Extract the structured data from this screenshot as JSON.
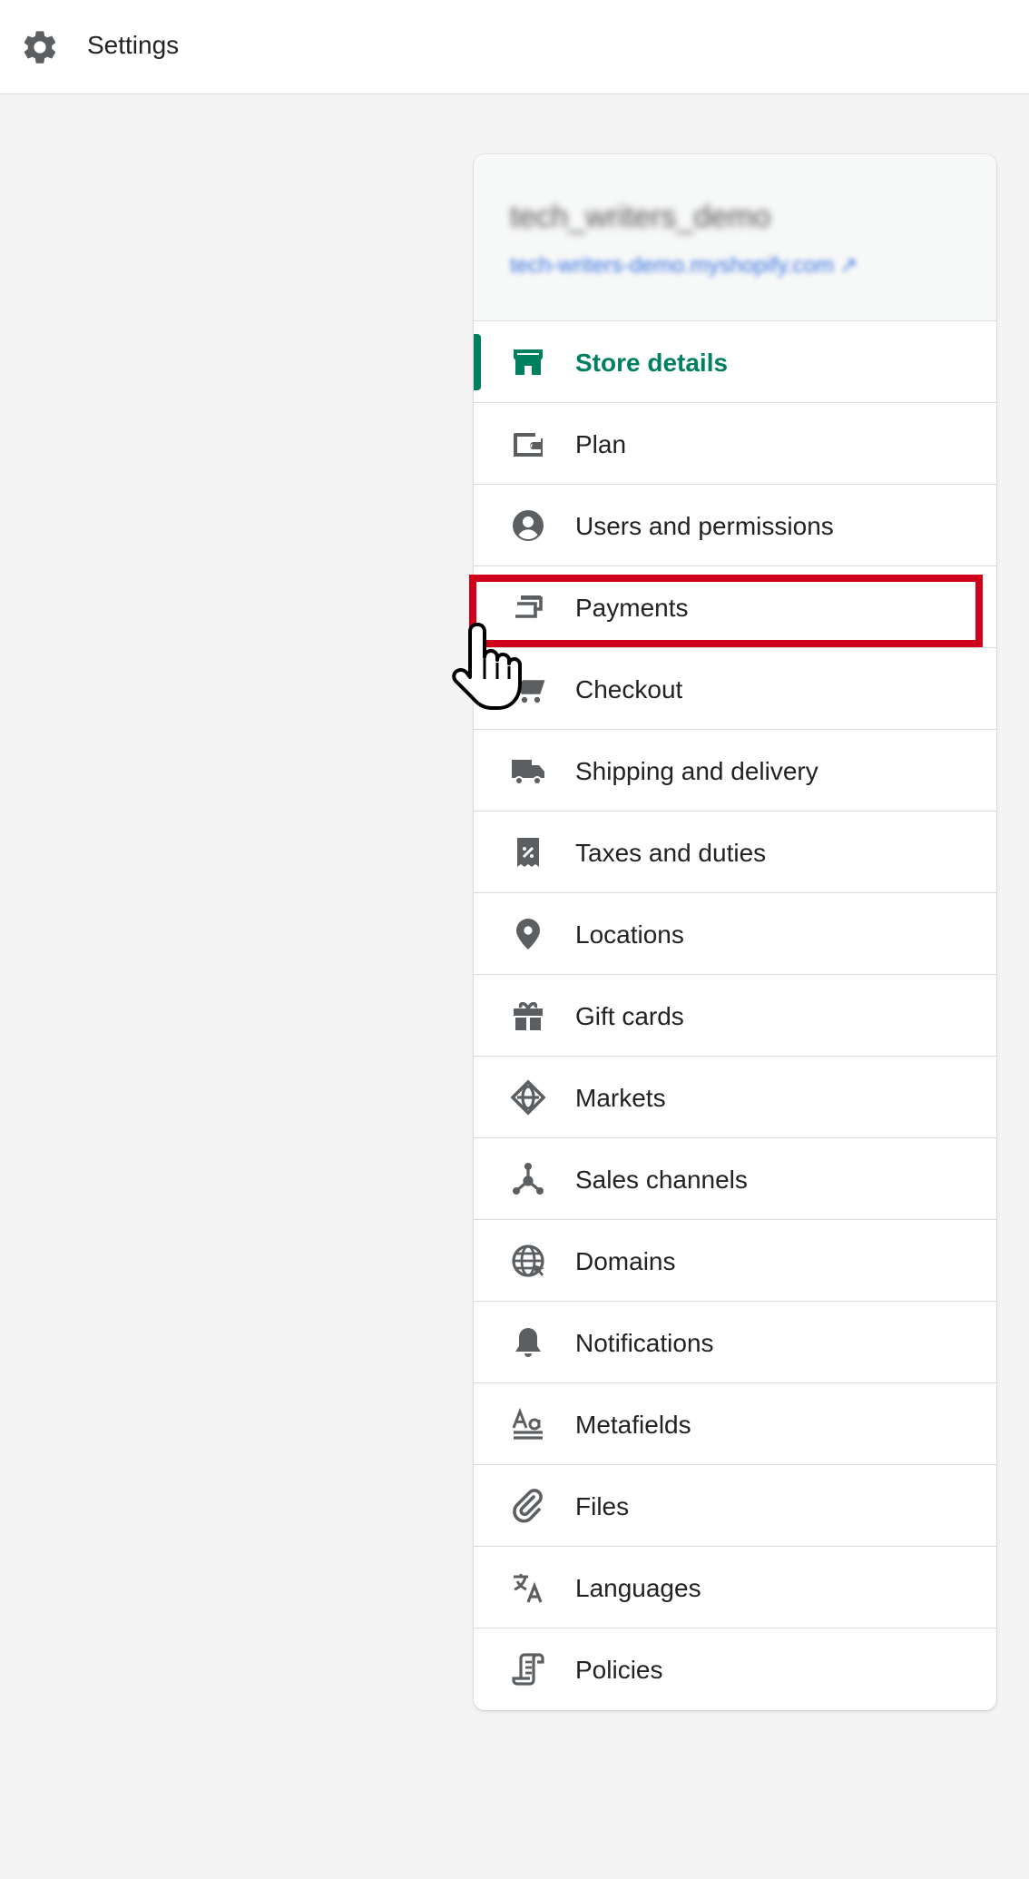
{
  "header": {
    "title": "Settings",
    "icon": "gear-icon"
  },
  "store": {
    "name": "tech_writers_demo",
    "url": "tech-writers-demo.myshopify.com"
  },
  "colors": {
    "accent": "#008060",
    "highlight": "#d0021b",
    "icon": "#5c5f62"
  },
  "nav": {
    "items": [
      {
        "label": "Store details",
        "icon": "store-icon",
        "active": true
      },
      {
        "label": "Plan",
        "icon": "wallet-icon"
      },
      {
        "label": "Users and permissions",
        "icon": "user-icon"
      },
      {
        "label": "Payments",
        "icon": "payments-icon",
        "highlighted": true
      },
      {
        "label": "Checkout",
        "icon": "cart-icon"
      },
      {
        "label": "Shipping and delivery",
        "icon": "truck-icon"
      },
      {
        "label": "Taxes and duties",
        "icon": "tax-receipt-icon"
      },
      {
        "label": "Locations",
        "icon": "location-pin-icon"
      },
      {
        "label": "Gift cards",
        "icon": "gift-icon"
      },
      {
        "label": "Markets",
        "icon": "markets-globe-icon"
      },
      {
        "label": "Sales channels",
        "icon": "sales-channels-icon"
      },
      {
        "label": "Domains",
        "icon": "domains-globe-icon"
      },
      {
        "label": "Notifications",
        "icon": "bell-icon"
      },
      {
        "label": "Metafields",
        "icon": "metafields-icon"
      },
      {
        "label": "Files",
        "icon": "paperclip-icon"
      },
      {
        "label": "Languages",
        "icon": "translate-icon"
      },
      {
        "label": "Policies",
        "icon": "policy-scroll-icon"
      }
    ]
  }
}
